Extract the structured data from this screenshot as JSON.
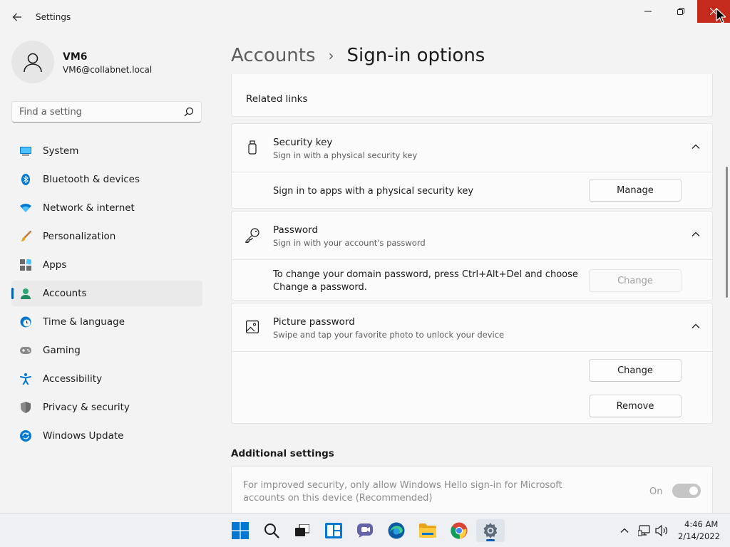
{
  "window": {
    "app_title": "Settings",
    "accent": "#005fb8",
    "close_hover_color": "#c42b1c"
  },
  "profile": {
    "name": "VM6",
    "email": "VM6@collabnet.local"
  },
  "search": {
    "placeholder": "Find a setting"
  },
  "sidebar": {
    "items": [
      {
        "label": "System",
        "icon": "monitor-icon",
        "active": false
      },
      {
        "label": "Bluetooth & devices",
        "icon": "bluetooth-icon",
        "active": false
      },
      {
        "label": "Network & internet",
        "icon": "wifi-icon",
        "active": false
      },
      {
        "label": "Personalization",
        "icon": "brush-icon",
        "active": false
      },
      {
        "label": "Apps",
        "icon": "apps-icon",
        "active": false
      },
      {
        "label": "Accounts",
        "icon": "person-icon",
        "active": true
      },
      {
        "label": "Time & language",
        "icon": "globe-clock-icon",
        "active": false
      },
      {
        "label": "Gaming",
        "icon": "gamepad-icon",
        "active": false
      },
      {
        "label": "Accessibility",
        "icon": "accessibility-icon",
        "active": false
      },
      {
        "label": "Privacy & security",
        "icon": "shield-icon",
        "active": false
      },
      {
        "label": "Windows Update",
        "icon": "update-icon",
        "active": false
      }
    ]
  },
  "header": {
    "parent": "Accounts",
    "separator": "›",
    "current": "Sign-in options"
  },
  "related_links": {
    "label": "Related links"
  },
  "security_key": {
    "title": "Security key",
    "description": "Sign in with a physical security key",
    "row_text": "Sign in to apps with a physical security key",
    "button": "Manage"
  },
  "password": {
    "title": "Password",
    "description": "Sign in with your account's password",
    "row_text": "To change your domain password, press Ctrl+Alt+Del and choose Change a password.",
    "button": "Change",
    "button_disabled": true
  },
  "picture_password": {
    "title": "Picture password",
    "description": "Swipe and tap your favorite photo to unlock your device",
    "change_button": "Change",
    "remove_button": "Remove"
  },
  "additional": {
    "section_title": "Additional settings",
    "text": "For improved security, only allow Windows Hello sign-in for Microsoft accounts on this device (Recommended)",
    "toggle_state": "On",
    "toggle_on": true,
    "disabled": true
  },
  "taskbar": {
    "apps": [
      "start-icon",
      "search-icon",
      "task-view-icon",
      "widgets-icon",
      "chat-icon",
      "edge-icon",
      "file-explorer-icon",
      "chrome-icon",
      "settings-icon"
    ],
    "active_app": "settings-icon",
    "time": "4:46 AM",
    "date": "2/14/2022"
  }
}
